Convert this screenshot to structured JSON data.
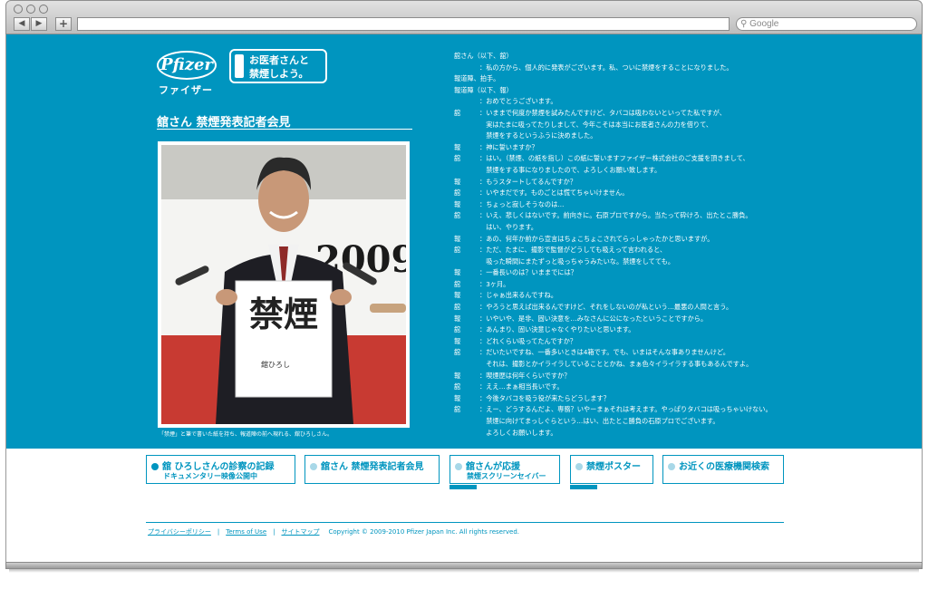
{
  "browser": {
    "nav_back": "◀",
    "nav_forward": "▶",
    "add_tab": "+",
    "search_placeholder": "Google"
  },
  "logo": {
    "brand": "Pfizer",
    "katakana": "ファイザー"
  },
  "campaign_badge": "お医者さんと\n禁煙しよう。",
  "page_title": "舘さん 禁煙発表記者会見",
  "photo": {
    "banner_year": "2009年",
    "paper_kanji": "禁煙",
    "paper_signature": "舘ひろし"
  },
  "photo_caption": "「禁煙」と筆で書いた紙を持ち、報道陣の前へ現れる、舘ひろしさん。",
  "transcript": [
    {
      "speaker": "舘さん（以下、舘）",
      "text": ""
    },
    {
      "speaker": "",
      "text": "：私の方から、個人的に発表がございます。私、ついに禁煙をすることになりました。"
    },
    {
      "speaker": "報道陣、拍手。",
      "text": ""
    },
    {
      "speaker": "報道陣（以下、報）",
      "text": ""
    },
    {
      "speaker": "",
      "text": "：おめでとうございます。"
    },
    {
      "speaker": "舘",
      "text": "：いままで何度か禁煙を試みたんですけど、タバコは吸わないといってた私ですが、"
    },
    {
      "speaker": "",
      "text": "　実はたまに吸ってたりしまして、今年こそは本当にお医者さんの力を借りて、"
    },
    {
      "speaker": "",
      "text": "　禁煙をするというふうに決めました。"
    },
    {
      "speaker": "報",
      "text": "：神に誓いますか？"
    },
    {
      "speaker": "舘",
      "text": "：はい。（禁煙、の紙を指し）この紙に誓いますファイザー株式会社のご支援を頂きまして、"
    },
    {
      "speaker": "",
      "text": "　禁煙をする事になりましたので、よろしくお願い致します。"
    },
    {
      "speaker": "報",
      "text": "：もうスタートしてるんですか？"
    },
    {
      "speaker": "舘",
      "text": "：いやまだです。ものごとは慌てちゃいけません。"
    },
    {
      "speaker": "報",
      "text": "：ちょっと寂しそうなのは…"
    },
    {
      "speaker": "舘",
      "text": "：いえ、悲しくはないです。前向きに。石原プロですから。当たって砕けろ、出たとこ勝負。"
    },
    {
      "speaker": "",
      "text": "　はい、やります。"
    },
    {
      "speaker": "報",
      "text": "：あの、何年か前から宣言はちょこちょこされてらっしゃったかと思いますが。"
    },
    {
      "speaker": "舘",
      "text": "：ただ、たまに、撮影で監督がどうしても吸えって言われると、"
    },
    {
      "speaker": "",
      "text": "　吸った瞬間にまたずっと吸っちゃうみたいな。禁煙をしてても。"
    },
    {
      "speaker": "報",
      "text": "：一番長いのは？いままでには？"
    },
    {
      "speaker": "舘",
      "text": "：3ヶ月。"
    },
    {
      "speaker": "報",
      "text": "：じゃぁ出来るんですね。"
    },
    {
      "speaker": "舘",
      "text": "：やろうと思えば出来るんですけど、それをしないのが私という…最悪の人間と言う。"
    },
    {
      "speaker": "報",
      "text": "：いやいや、是非、固い決意を…みなさんに公になったということですから。"
    },
    {
      "speaker": "舘",
      "text": "：あんまり、固い決意じゃなくやりたいと思います。"
    },
    {
      "speaker": "報",
      "text": "：どれくらい吸ってたんですか？"
    },
    {
      "speaker": "舘",
      "text": "：だいたいですね、一番多いときは4箱です。でも、いまはそんな事ありませんけど。"
    },
    {
      "speaker": "",
      "text": "　それは、撮影とかイライラしていることとかね、まぁ色々イライラする事もあるんですよ。"
    },
    {
      "speaker": "報",
      "text": "：喫煙歴は何年くらいですか？"
    },
    {
      "speaker": "舘",
      "text": "：ええ…まぁ相当長いです。"
    },
    {
      "speaker": "報",
      "text": "：今後タバコを吸う役が来たらどうします？"
    },
    {
      "speaker": "舘",
      "text": "：えー、どうするんだよ、専務？いやーまぁそれは考えます。やっぱりタバコは吸っちゃいけない。"
    },
    {
      "speaker": "",
      "text": "　禁煙に向けてまっしぐらという…はい、出たとこ勝負の石原プロでございます。"
    },
    {
      "speaker": "",
      "text": "　よろしくお願いします。"
    }
  ],
  "nav_boxes": [
    {
      "line1": "舘 ひろしさんの診察の記録",
      "line2": "ドキュメンタリー映像公開中",
      "dot_color": "#0095bf"
    },
    {
      "line1": "舘さん 禁煙発表記者会見",
      "line2": "",
      "dot_color": "#a8d8e8"
    },
    {
      "line1": "舘さんが応援",
      "line2": "禁煙スクリーンセイバー",
      "dot_color": "#a8d8e8"
    },
    {
      "line1": "禁煙ポスター",
      "line2": "",
      "dot_color": "#a8d8e8"
    },
    {
      "line1": "お近くの医療機関検索",
      "line2": "",
      "dot_color": "#a8d8e8"
    }
  ],
  "footer": {
    "privacy": "プライバシーポリシー",
    "terms": "Terms of Use",
    "sitemap": "サイトマップ",
    "copyright": "Copyright © 2009-2010 Pfizer Japan Inc. All rights reserved."
  },
  "colors": {
    "brand_blue": "#0095bf"
  }
}
